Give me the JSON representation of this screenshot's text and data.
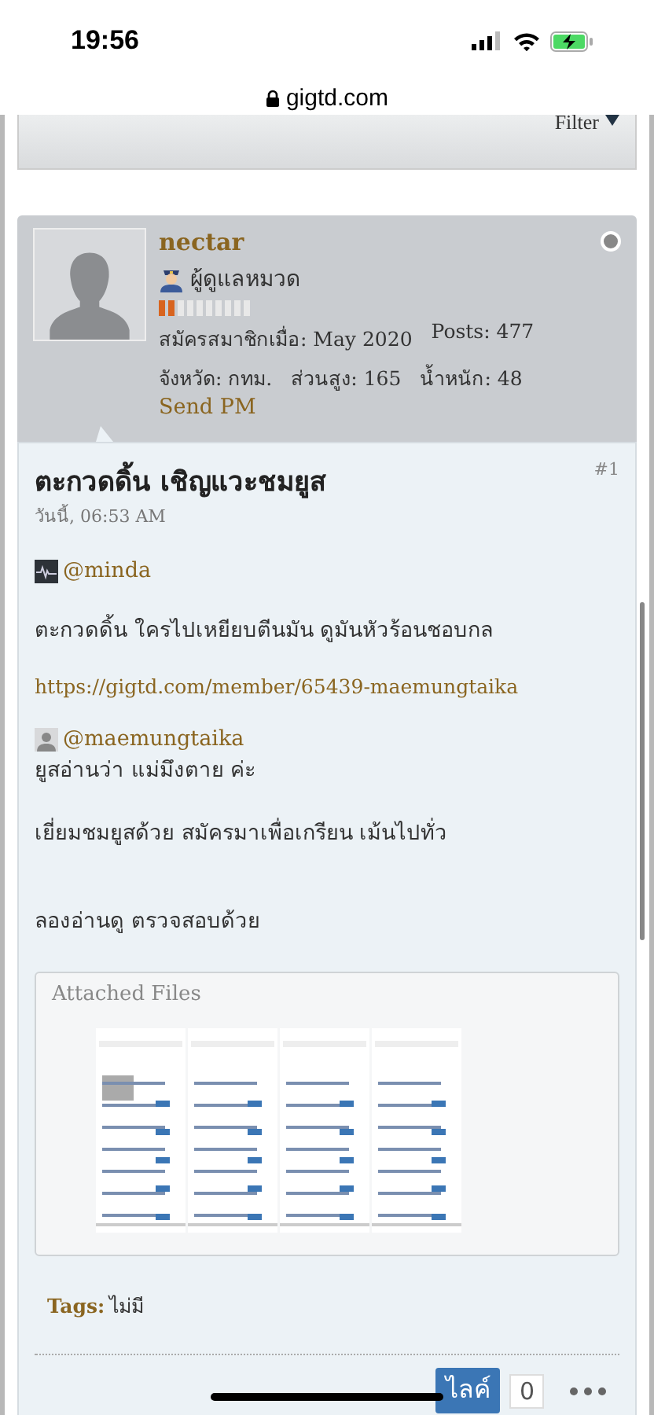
{
  "status_bar": {
    "time": "19:56"
  },
  "address_bar": {
    "url": "gigtd.com"
  },
  "filter": {
    "label": "Filter"
  },
  "post": {
    "author": {
      "name": "nectar",
      "online": false,
      "rank": "ผู้ดูแลหมวด",
      "reputation": {
        "level": 0.2
      },
      "joined": "สมัครสมาชิกเมื่อ: May 2020",
      "posts": "Posts: 477",
      "province": "จังหวัด: กทม.",
      "height": "ส่วนสูง: 165",
      "weight": "น้ำหนัก: 48",
      "send_pm": "Send PM"
    },
    "number": "#1",
    "title": "ตะกวดดิ้น เชิญแวะชมยูส",
    "date": "วันนี้, 06:53 AM",
    "body": [
      {
        "kind": "mention",
        "text": "@minda"
      },
      {
        "kind": "text",
        "text": "ตะกวดดิ้น ใครไปเหยียบตีนมัน ดูมันหัวร้อนชอบกล"
      },
      {
        "kind": "link",
        "text": "https://gigtd.com/member/65439-maemungtaika"
      },
      {
        "kind": "quote",
        "text": "@maemungtaika",
        "line": "ยูสอ่านว่า แม่มึงตาย ค่ะ"
      },
      {
        "kind": "text",
        "text": "เยี่ยมชมยูสด้วย สมัครมาเพื่อเกรียน เม้นไปทั่ว"
      },
      {
        "kind": "gap"
      },
      {
        "kind": "text",
        "text": "ลองอ่านดู ตรวจสอบด้วย"
      }
    ],
    "attachments": {
      "title": "Attached Files"
    },
    "tags": {
      "label": "Tags:",
      "value": "ไม่มี"
    },
    "like": {
      "label": "ไลค์",
      "count": "0"
    }
  }
}
